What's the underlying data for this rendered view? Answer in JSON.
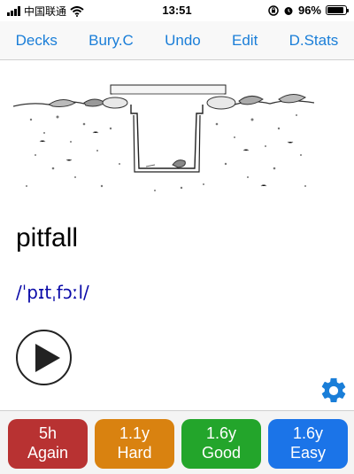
{
  "status_bar": {
    "carrier": "中国联通",
    "time": "13:51",
    "battery_percent": "96%",
    "battery_level": 0.96
  },
  "nav": {
    "decks": "Decks",
    "bury": "Bury.C",
    "undo": "Undo",
    "edit": "Edit",
    "stats": "D.Stats"
  },
  "card": {
    "word": "pitfall",
    "phonetic": "/ˈpɪtˌfɔːl/",
    "image_icon": "pitfall-trap-illustration",
    "play_icon": "play-icon",
    "settings_icon": "gear-icon",
    "settings_color": "#1a7ed8"
  },
  "answers": [
    {
      "interval": "5h",
      "label": "Again",
      "color": "#b83232"
    },
    {
      "interval": "1.1y",
      "label": "Hard",
      "color": "#d98210"
    },
    {
      "interval": "1.6y",
      "label": "Good",
      "color": "#23a52b"
    },
    {
      "interval": "1.6y",
      "label": "Easy",
      "color": "#1b74e8"
    }
  ]
}
